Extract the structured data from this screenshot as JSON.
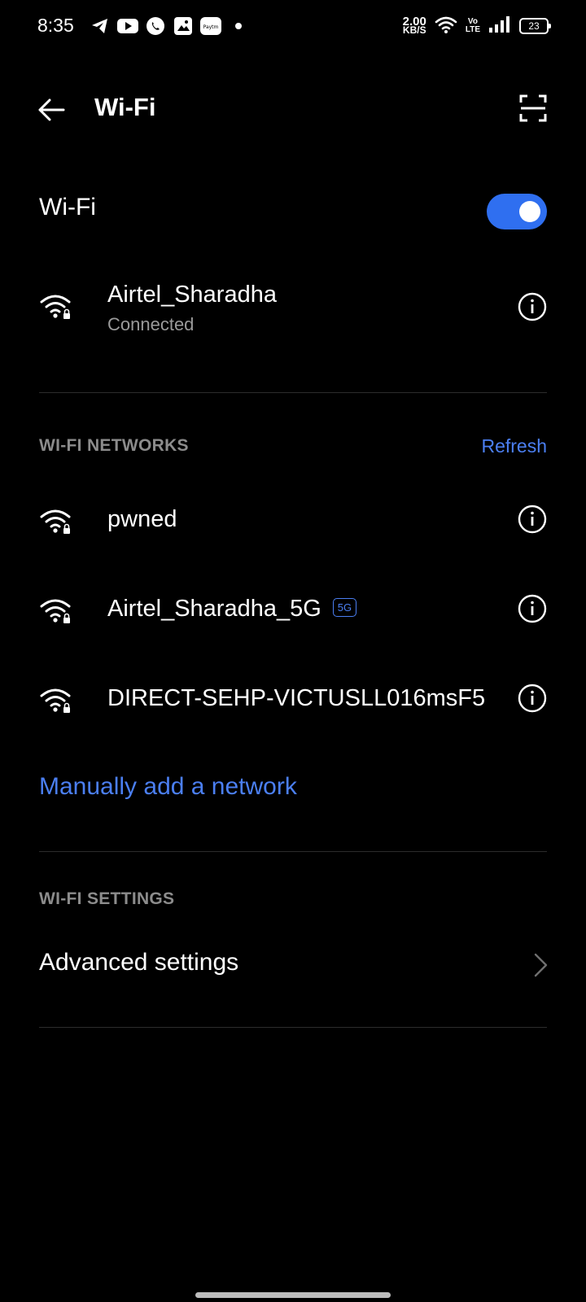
{
  "status_bar": {
    "time": "8:35",
    "net_speed_value": "2.00",
    "net_speed_unit": "KB/S",
    "volte_top": "Vo",
    "volte_bottom": "LTE",
    "battery": "23",
    "app_icons": [
      "telegram-icon",
      "youtube-icon",
      "whatsapp-icon",
      "gallery-icon",
      "paytm-icon",
      "notification-dot-icon"
    ],
    "paytm_text": "Paytm"
  },
  "header": {
    "title": "Wi-Fi"
  },
  "wifi_toggle": {
    "label": "Wi-Fi",
    "enabled": true,
    "accent": "#2f6ff0"
  },
  "connected_network": {
    "name": "Airtel_Sharadha",
    "status": "Connected"
  },
  "networks_section": {
    "title": "WI-FI NETWORKS",
    "refresh_label": "Refresh",
    "items": [
      {
        "name": "pwned",
        "badge": ""
      },
      {
        "name": "Airtel_Sharadha_5G",
        "badge": "5G"
      },
      {
        "name": "DIRECT-SEHP-VICTUSLL016msF5",
        "badge": ""
      }
    ]
  },
  "manual_add": {
    "label": "Manually add a network"
  },
  "settings_section": {
    "title": "WI-FI SETTINGS",
    "advanced_label": "Advanced settings"
  },
  "colors": {
    "link": "#4b7ff2",
    "secondary_text": "#9a9a9a",
    "section_text": "#8c8c8c",
    "background": "#000000"
  }
}
